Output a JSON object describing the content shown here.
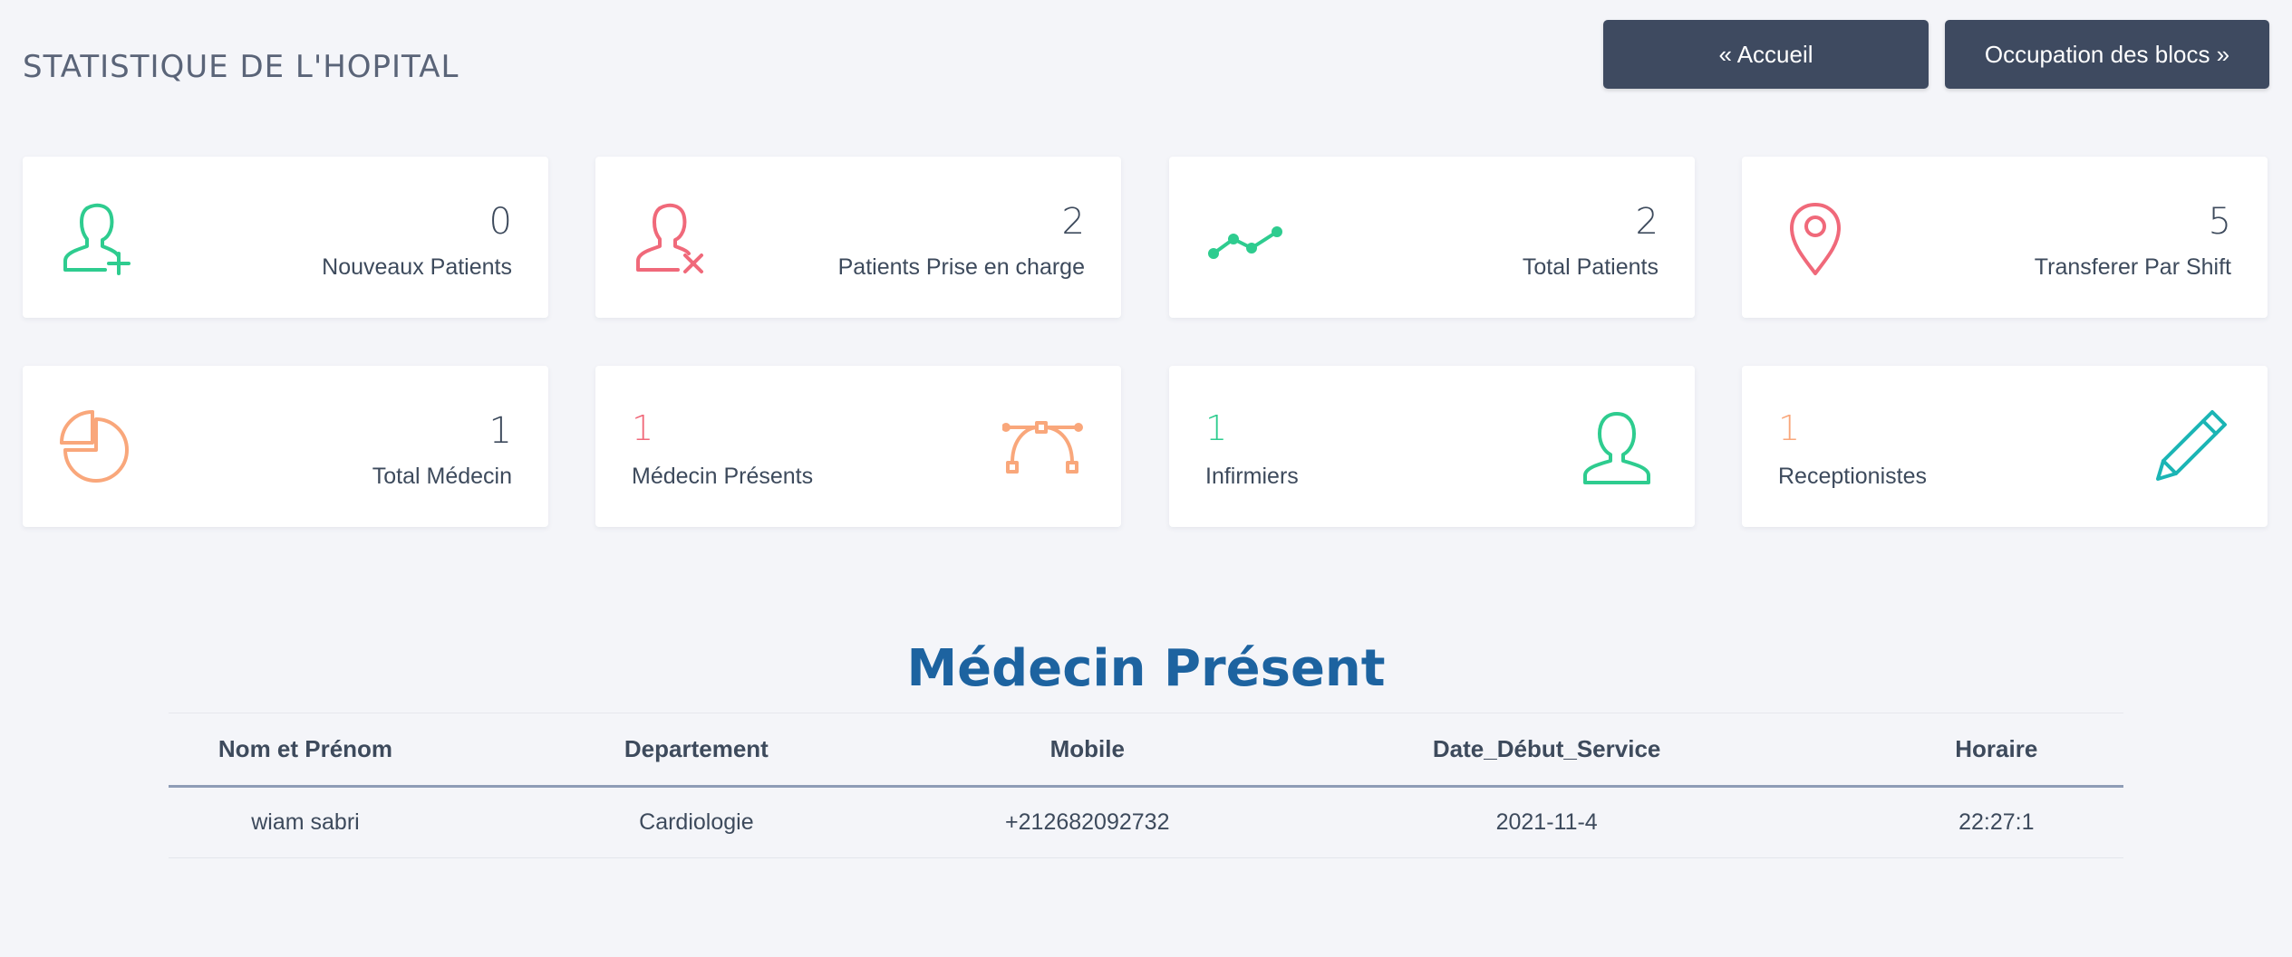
{
  "header": {
    "title": "STATISTIQUE DE L'HOPITAL",
    "home_button": "« Accueil",
    "blocks_button": "Occupation des blocs »"
  },
  "stats_row1": [
    {
      "value": "0",
      "label": "Nouveaux Patients",
      "icon": "user-plus-icon",
      "color": "#2ecc8f"
    },
    {
      "value": "2",
      "label": "Patients Prise en charge",
      "icon": "user-remove-icon",
      "color": "#f0697a"
    },
    {
      "value": "2",
      "label": "Total Patients",
      "icon": "trend-line-icon",
      "color": "#2ecc8f"
    },
    {
      "value": "5",
      "label": "Transferer Par Shift",
      "icon": "map-pin-icon",
      "color": "#f0697a"
    }
  ],
  "stats_row2": [
    {
      "value": "1",
      "label": "Total Médecin",
      "icon": "pie-chart-icon",
      "color": "#f9a77b"
    },
    {
      "value": "1",
      "label": "Médecin Présents",
      "icon": "bezier-curve-icon",
      "color": "#f9a77b",
      "value_color": "#f0697a"
    },
    {
      "value": "1",
      "label": "Infirmiers",
      "icon": "user-icon",
      "color": "#2ecc8f",
      "value_color": "#2ecc8f"
    },
    {
      "value": "1",
      "label": "Receptionistes",
      "icon": "pencil-icon",
      "color": "#1bb5b5",
      "value_color": "#f9a77b"
    }
  ],
  "section": {
    "title": "Médecin Présent"
  },
  "table": {
    "headers": [
      "Nom et Prénom",
      "Departement",
      "Mobile",
      "Date_Début_Service",
      "Horaire"
    ],
    "rows": [
      [
        "wiam sabri",
        "Cardiologie",
        "+212682092732",
        "2021-11-4",
        "22:27:1"
      ]
    ]
  }
}
